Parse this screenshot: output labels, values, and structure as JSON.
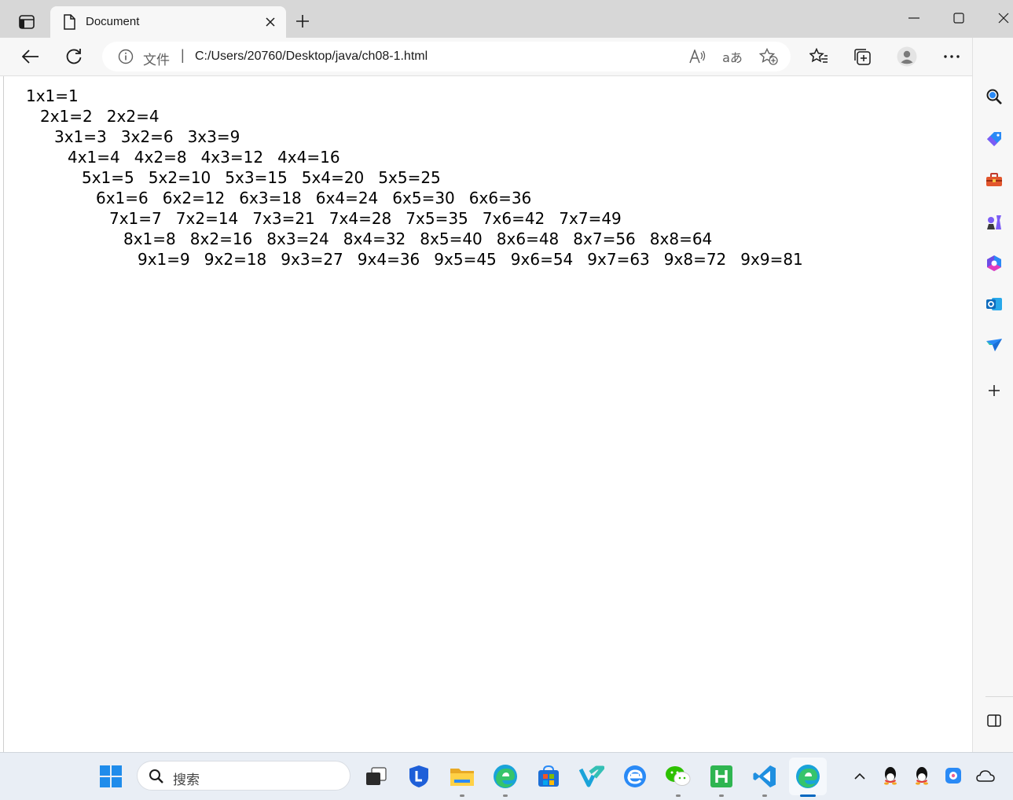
{
  "window": {
    "tab_title": "Document"
  },
  "address_bar": {
    "file_label": "文件",
    "separator": "|",
    "url": "C:/Users/20760/Desktop/java/ch08-1.html"
  },
  "icons": {
    "tab_actions": "tab-actions-icon",
    "page": "document-icon",
    "close_tab": "close-icon",
    "new_tab": "plus-icon",
    "back": "back-arrow-icon",
    "refresh": "refresh-icon",
    "info": "info-icon",
    "read_aloud": "read-aloud-icon",
    "translate": "translate-icon",
    "add_favorite": "star-plus-icon",
    "favorites": "favorites-icon",
    "collections": "collections-icon",
    "profile": "profile-icon",
    "more": "more-icon",
    "copilot": "bing-icon"
  },
  "multiplication_table": [
    [
      "1x1=1"
    ],
    [
      "2x1=2",
      "2x2=4"
    ],
    [
      "3x1=3",
      "3x2=6",
      "3x3=9"
    ],
    [
      "4x1=4",
      "4x2=8",
      "4x3=12",
      "4x4=16"
    ],
    [
      "5x1=5",
      "5x2=10",
      "5x3=15",
      "5x4=20",
      "5x5=25"
    ],
    [
      "6x1=6",
      "6x2=12",
      "6x3=18",
      "6x4=24",
      "6x5=30",
      "6x6=36"
    ],
    [
      "7x1=7",
      "7x2=14",
      "7x3=21",
      "7x4=28",
      "7x5=35",
      "7x6=42",
      "7x7=49"
    ],
    [
      "8x1=8",
      "8x2=16",
      "8x3=24",
      "8x4=32",
      "8x5=40",
      "8x6=48",
      "8x7=56",
      "8x8=64"
    ],
    [
      "9x1=9",
      "9x2=18",
      "9x3=27",
      "9x4=36",
      "9x5=45",
      "9x6=54",
      "9x7=63",
      "9x8=72",
      "9x9=81"
    ]
  ],
  "sidebar": [
    "search-icon",
    "tag-icon",
    "toolbox-icon",
    "games-icon",
    "microsoft365-icon",
    "outlook-icon",
    "send-icon",
    "add-icon",
    "sidebar-toggle-icon"
  ],
  "taskbar": {
    "search_placeholder": "搜索"
  },
  "colors": {
    "accent": "#0067c0",
    "tabstrip": "#d7d7d7",
    "toolbar": "#f7f7f7",
    "taskbar": "#e9eef5"
  }
}
